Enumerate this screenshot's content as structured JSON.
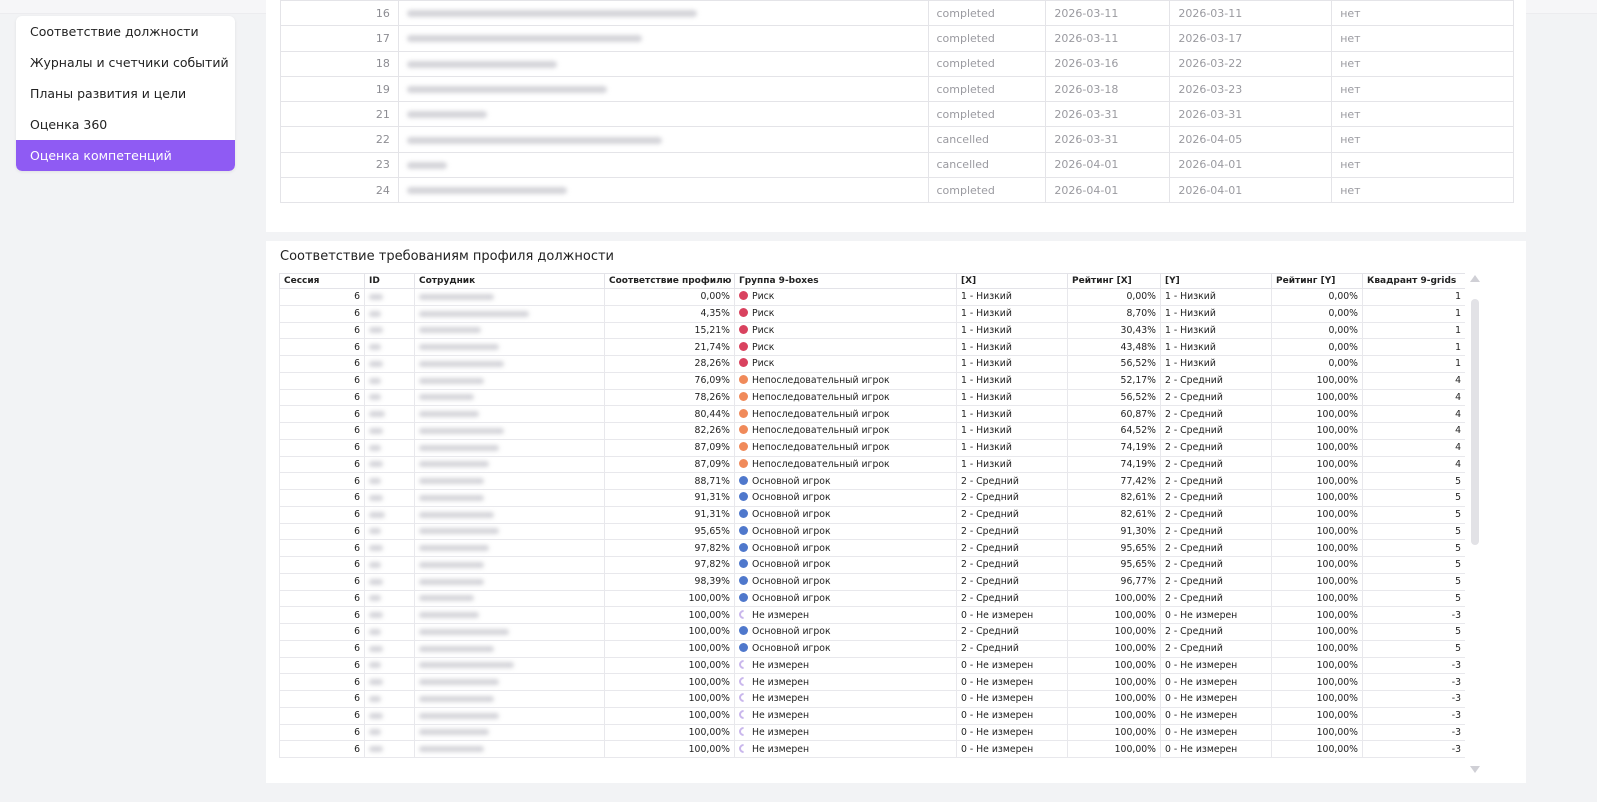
{
  "sidebar": {
    "items": [
      {
        "label": "Соответствие должности",
        "active": false
      },
      {
        "label": "Журналы и счетчики событий",
        "active": false
      },
      {
        "label": "Планы развития и цели",
        "active": false
      },
      {
        "label": "Оценка 360",
        "active": false
      },
      {
        "label": "Оценка компетенций",
        "active": true
      }
    ]
  },
  "top_table": {
    "rows": [
      {
        "num": "16",
        "status": "completed",
        "start": "2026-03-11",
        "end": "2026-03-11",
        "flag": "нет"
      },
      {
        "num": "17",
        "status": "completed",
        "start": "2026-03-11",
        "end": "2026-03-17",
        "flag": "нет"
      },
      {
        "num": "18",
        "status": "completed",
        "start": "2026-03-16",
        "end": "2026-03-22",
        "flag": "нет"
      },
      {
        "num": "19",
        "status": "completed",
        "start": "2026-03-18",
        "end": "2026-03-23",
        "flag": "нет"
      },
      {
        "num": "21",
        "status": "completed",
        "start": "2026-03-31",
        "end": "2026-03-31",
        "flag": "нет"
      },
      {
        "num": "22",
        "status": "cancelled",
        "start": "2026-03-31",
        "end": "2026-04-05",
        "flag": "нет"
      },
      {
        "num": "23",
        "status": "cancelled",
        "start": "2026-04-01",
        "end": "2026-04-01",
        "flag": "нет"
      },
      {
        "num": "24",
        "status": "completed",
        "start": "2026-04-01",
        "end": "2026-04-01",
        "flag": "нет"
      }
    ]
  },
  "profile_section": {
    "title": "Соответствие требованиям профиля должности",
    "columns": [
      "Сессия",
      "ID",
      "Сотрудник",
      "Соответствие профилю",
      "Группа 9-boxes",
      "[X]",
      "Рейтинг [X]",
      "[Y]",
      "Рейтинг [Y]",
      "Квадрант 9-grids"
    ],
    "rows": [
      {
        "session": "6",
        "fit": "0,00%",
        "group": "Риск",
        "dot": "risk",
        "x": "1 - Низкий",
        "rx": "0,00%",
        "y": "1 - Низкий",
        "ry": "0,00%",
        "q": "1"
      },
      {
        "session": "6",
        "fit": "4,35%",
        "group": "Риск",
        "dot": "risk",
        "x": "1 - Низкий",
        "rx": "8,70%",
        "y": "1 - Низкий",
        "ry": "0,00%",
        "q": "1"
      },
      {
        "session": "6",
        "fit": "15,21%",
        "group": "Риск",
        "dot": "risk",
        "x": "1 - Низкий",
        "rx": "30,43%",
        "y": "1 - Низкий",
        "ry": "0,00%",
        "q": "1"
      },
      {
        "session": "6",
        "fit": "21,74%",
        "group": "Риск",
        "dot": "risk",
        "x": "1 - Низкий",
        "rx": "43,48%",
        "y": "1 - Низкий",
        "ry": "0,00%",
        "q": "1"
      },
      {
        "session": "6",
        "fit": "28,26%",
        "group": "Риск",
        "dot": "risk",
        "x": "1 - Низкий",
        "rx": "56,52%",
        "y": "1 - Низкий",
        "ry": "0,00%",
        "q": "1"
      },
      {
        "session": "6",
        "fit": "76,09%",
        "group": "Непоследовательный игрок",
        "dot": "inc",
        "x": "1 - Низкий",
        "rx": "52,17%",
        "y": "2 - Средний",
        "ry": "100,00%",
        "q": "4"
      },
      {
        "session": "6",
        "fit": "78,26%",
        "group": "Непоследовательный игрок",
        "dot": "inc",
        "x": "1 - Низкий",
        "rx": "56,52%",
        "y": "2 - Средний",
        "ry": "100,00%",
        "q": "4"
      },
      {
        "session": "6",
        "fit": "80,44%",
        "group": "Непоследовательный игрок",
        "dot": "inc",
        "x": "1 - Низкий",
        "rx": "60,87%",
        "y": "2 - Средний",
        "ry": "100,00%",
        "q": "4"
      },
      {
        "session": "6",
        "fit": "82,26%",
        "group": "Непоследовательный игрок",
        "dot": "inc",
        "x": "1 - Низкий",
        "rx": "64,52%",
        "y": "2 - Средний",
        "ry": "100,00%",
        "q": "4"
      },
      {
        "session": "6",
        "fit": "87,09%",
        "group": "Непоследовательный игрок",
        "dot": "inc",
        "x": "1 - Низкий",
        "rx": "74,19%",
        "y": "2 - Средний",
        "ry": "100,00%",
        "q": "4"
      },
      {
        "session": "6",
        "fit": "87,09%",
        "group": "Непоследовательный игрок",
        "dot": "inc",
        "x": "1 - Низкий",
        "rx": "74,19%",
        "y": "2 - Средний",
        "ry": "100,00%",
        "q": "4"
      },
      {
        "session": "6",
        "fit": "88,71%",
        "group": "Основной игрок",
        "dot": "core",
        "x": "2 - Средний",
        "rx": "77,42%",
        "y": "2 - Средний",
        "ry": "100,00%",
        "q": "5"
      },
      {
        "session": "6",
        "fit": "91,31%",
        "group": "Основной игрок",
        "dot": "core",
        "x": "2 - Средний",
        "rx": "82,61%",
        "y": "2 - Средний",
        "ry": "100,00%",
        "q": "5"
      },
      {
        "session": "6",
        "fit": "91,31%",
        "group": "Основной игрок",
        "dot": "core",
        "x": "2 - Средний",
        "rx": "82,61%",
        "y": "2 - Средний",
        "ry": "100,00%",
        "q": "5"
      },
      {
        "session": "6",
        "fit": "95,65%",
        "group": "Основной игрок",
        "dot": "core",
        "x": "2 - Средний",
        "rx": "91,30%",
        "y": "2 - Средний",
        "ry": "100,00%",
        "q": "5"
      },
      {
        "session": "6",
        "fit": "97,82%",
        "group": "Основной игрок",
        "dot": "core",
        "x": "2 - Средний",
        "rx": "95,65%",
        "y": "2 - Средний",
        "ry": "100,00%",
        "q": "5"
      },
      {
        "session": "6",
        "fit": "97,82%",
        "group": "Основной игрок",
        "dot": "core",
        "x": "2 - Средний",
        "rx": "95,65%",
        "y": "2 - Средний",
        "ry": "100,00%",
        "q": "5"
      },
      {
        "session": "6",
        "fit": "98,39%",
        "group": "Основной игрок",
        "dot": "core",
        "x": "2 - Средний",
        "rx": "96,77%",
        "y": "2 - Средний",
        "ry": "100,00%",
        "q": "5"
      },
      {
        "session": "6",
        "fit": "100,00%",
        "group": "Основной игрок",
        "dot": "core",
        "x": "2 - Средний",
        "rx": "100,00%",
        "y": "2 - Средний",
        "ry": "100,00%",
        "q": "5"
      },
      {
        "session": "6",
        "fit": "100,00%",
        "group": "Не измерен",
        "dot": "none",
        "x": "0 - Не измерен",
        "rx": "100,00%",
        "y": "0 - Не измерен",
        "ry": "100,00%",
        "q": "-3"
      },
      {
        "session": "6",
        "fit": "100,00%",
        "group": "Основной игрок",
        "dot": "core",
        "x": "2 - Средний",
        "rx": "100,00%",
        "y": "2 - Средний",
        "ry": "100,00%",
        "q": "5"
      },
      {
        "session": "6",
        "fit": "100,00%",
        "group": "Основной игрок",
        "dot": "core",
        "x": "2 - Средний",
        "rx": "100,00%",
        "y": "2 - Средний",
        "ry": "100,00%",
        "q": "5"
      },
      {
        "session": "6",
        "fit": "100,00%",
        "group": "Не измерен",
        "dot": "none",
        "x": "0 - Не измерен",
        "rx": "100,00%",
        "y": "0 - Не измерен",
        "ry": "100,00%",
        "q": "-3"
      },
      {
        "session": "6",
        "fit": "100,00%",
        "group": "Не измерен",
        "dot": "none",
        "x": "0 - Не измерен",
        "rx": "100,00%",
        "y": "0 - Не измерен",
        "ry": "100,00%",
        "q": "-3"
      },
      {
        "session": "6",
        "fit": "100,00%",
        "group": "Не измерен",
        "dot": "none",
        "x": "0 - Не измерен",
        "rx": "100,00%",
        "y": "0 - Не измерен",
        "ry": "100,00%",
        "q": "-3"
      },
      {
        "session": "6",
        "fit": "100,00%",
        "group": "Не измерен",
        "dot": "none",
        "x": "0 - Не измерен",
        "rx": "100,00%",
        "y": "0 - Не измерен",
        "ry": "100,00%",
        "q": "-3"
      },
      {
        "session": "6",
        "fit": "100,00%",
        "group": "Не измерен",
        "dot": "none",
        "x": "0 - Не измерен",
        "rx": "100,00%",
        "y": "0 - Не измерен",
        "ry": "100,00%",
        "q": "-3"
      },
      {
        "session": "6",
        "fit": "100,00%",
        "group": "Не измерен",
        "dot": "none",
        "x": "0 - Не измерен",
        "rx": "100,00%",
        "y": "0 - Не измерен",
        "ry": "100,00%",
        "q": "-3"
      }
    ]
  },
  "colors": {
    "accent": "#8f5bf3",
    "risk": "#d9425f",
    "inconsistent": "#f08a5a",
    "core": "#4f78cc",
    "not_measured": "#c9b6ec"
  }
}
